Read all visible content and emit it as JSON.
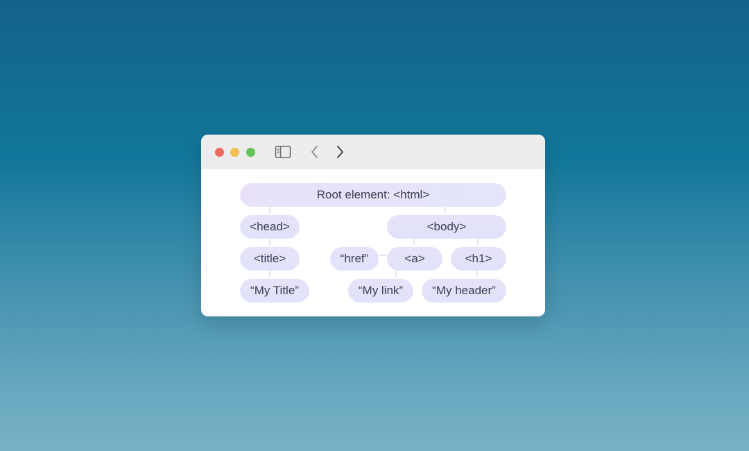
{
  "colors": {
    "close": "#ec6a5e",
    "minimize": "#f4bf4f",
    "maximize": "#61c554",
    "node_fill": "#e4e2fb",
    "connector": "#dfe4f3",
    "text": "#3e3e4e"
  },
  "toolbar": {
    "icons": [
      "sidebar-icon",
      "chevron-left-icon",
      "chevron-right-icon"
    ]
  },
  "tree": {
    "root": "Root element: <html>",
    "head": "<head>",
    "title": "<title>",
    "title_text": "“My Title”",
    "body": "<body>",
    "href": "“href”",
    "a": "<a>",
    "h1": "<h1>",
    "link_text": "“My link”",
    "header_text": "“My header”"
  }
}
